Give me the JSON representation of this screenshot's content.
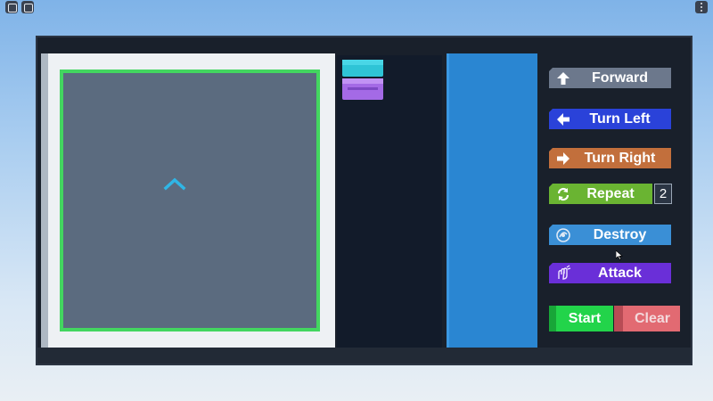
{
  "topbar": {
    "menu_icon": "roblox-menu-icon",
    "chat_icon": "chat-icon",
    "more_icon": "more-icon"
  },
  "board": {
    "player_icon": "chevron-up-icon",
    "border_color": "#43d660"
  },
  "script": {
    "placed_blocks": [
      "cyan-block",
      "purple-block"
    ]
  },
  "commands": {
    "forward": "Forward",
    "turn_left": "Turn Left",
    "turn_right": "Turn Right",
    "repeat": "Repeat",
    "repeat_count": "2",
    "destroy": "Destroy",
    "attack": "Attack"
  },
  "controls": {
    "start": "Start",
    "clear": "Clear"
  },
  "colors": {
    "forward": "#6c788c",
    "turn_left": "#2a42d9",
    "turn_right": "#c26f3c",
    "repeat": "#6ab432",
    "destroy": "#3a8fd6",
    "attack": "#6a2fd8",
    "start": "#22d44a",
    "clear": "#e26a72"
  }
}
